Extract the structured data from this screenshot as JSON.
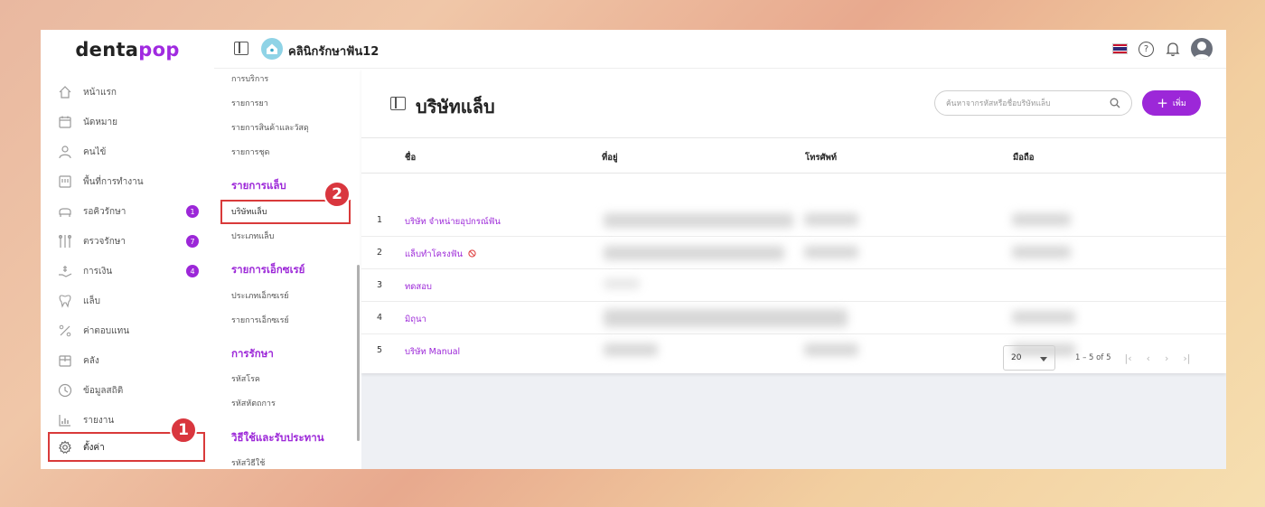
{
  "brand": {
    "name_prefix": "denta",
    "name_suffix": "pop"
  },
  "nav": {
    "items": [
      {
        "label": "หน้าแรก",
        "icon": "home-icon",
        "badge": ""
      },
      {
        "label": "นัดหมาย",
        "icon": "calendar-icon",
        "badge": ""
      },
      {
        "label": "คนไข้",
        "icon": "user-icon",
        "badge": ""
      },
      {
        "label": "พื้นที่การทำงาน",
        "icon": "workspace-icon",
        "badge": ""
      },
      {
        "label": "รอคิวรักษา",
        "icon": "dental-chair-icon",
        "badge": "1"
      },
      {
        "label": "ตรวจรักษา",
        "icon": "dental-tools-icon",
        "badge": "7"
      },
      {
        "label": "การเงิน",
        "icon": "money-hand-icon",
        "badge": "4"
      },
      {
        "label": "แล็บ",
        "icon": "tooth-icon",
        "badge": ""
      },
      {
        "label": "ค่าตอบแทน",
        "icon": "percent-icon",
        "badge": ""
      },
      {
        "label": "คลัง",
        "icon": "box-icon",
        "badge": ""
      },
      {
        "label": "ข้อมูลสถิติ",
        "icon": "stats-icon",
        "badge": ""
      },
      {
        "label": "รายงาน",
        "icon": "report-chart-icon",
        "badge": ""
      },
      {
        "label": "ตั้งค่า",
        "icon": "gear-icon",
        "badge": ""
      }
    ]
  },
  "annotations": {
    "step1": "1",
    "step2": "2"
  },
  "topbar": {
    "clinic_name": "คลินิกรักษาฟัน12"
  },
  "submenu": {
    "items_top": [
      "การบริการ",
      "รายการยา",
      "รายการสินค้าและวัสดุ",
      "รายการชุด"
    ],
    "lab_header": "รายการแล็บ",
    "lab_items": [
      "บริษัทแล็บ",
      "ประเภทแล็บ"
    ],
    "xray_header": "รายการเอ็กซเรย์",
    "xray_items": [
      "ประเภทเอ็กซเรย์",
      "รายการเอ็กซเรย์"
    ],
    "treat_header": "การรักษา",
    "treat_items": [
      "รหัสโรค",
      "รหัสหัตถการ"
    ],
    "usage_header": "วิธีใช้และรับประทาน",
    "usage_items": [
      "รหัสวิธีใช้"
    ]
  },
  "main": {
    "title": "บริษัทแล็บ",
    "search_placeholder": "ค้นหาจากรหัสหรือชื่อบริษัทแล็บ",
    "add_label": "เพิ่ม",
    "columns": [
      "ชื่อ",
      "ที่อยู่",
      "โทรศัพท์",
      "มือถือ"
    ],
    "rows": [
      {
        "index": "1",
        "name": "บริษัท จำหน่ายอุปกรณ์ฟัน",
        "disabled": false
      },
      {
        "index": "2",
        "name": "แล็บทำโครงฟัน",
        "disabled": true
      },
      {
        "index": "3",
        "name": "ทดสอบ",
        "disabled": false
      },
      {
        "index": "4",
        "name": "มิถุนา",
        "disabled": false
      },
      {
        "index": "5",
        "name": "บริษัท Manual",
        "disabled": false
      }
    ],
    "pagination": {
      "per_page": "20",
      "range": "1 – 5 of 5"
    }
  },
  "colors": {
    "accent": "#9c27d8",
    "highlight": "#d93a3a"
  }
}
